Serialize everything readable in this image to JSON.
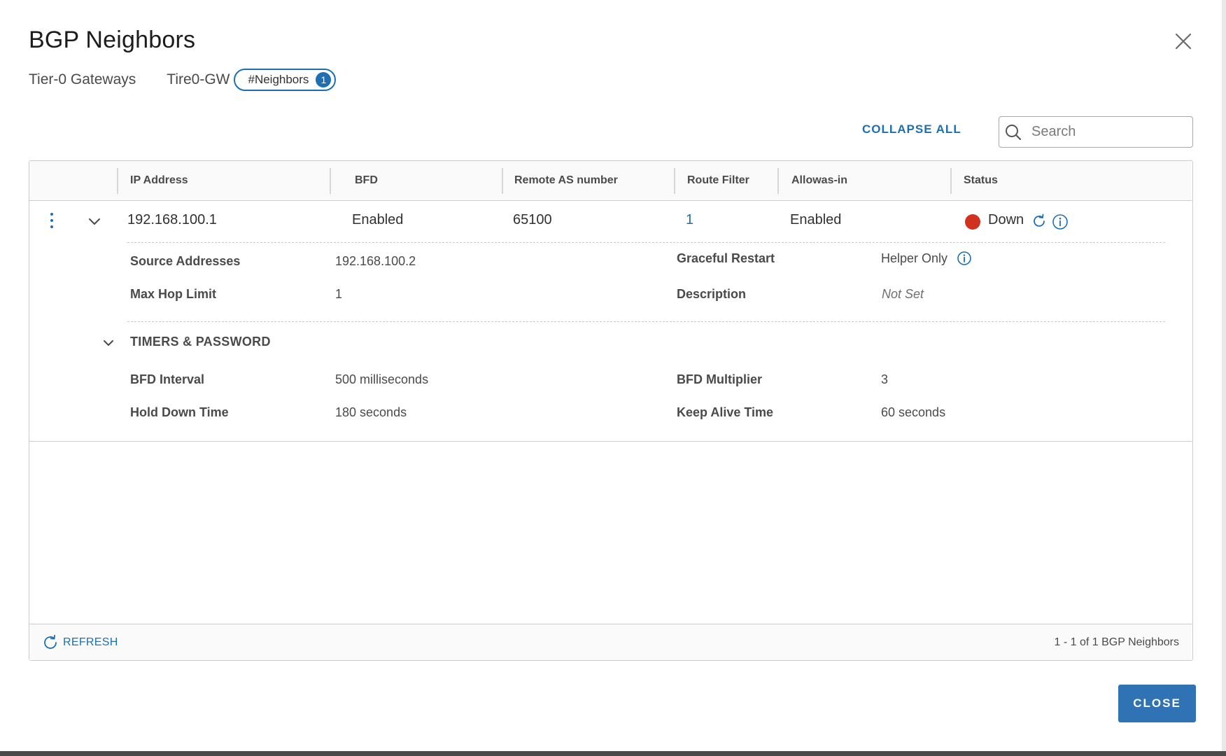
{
  "dialog": {
    "title": "BGP Neighbors",
    "close_icon": "close-icon"
  },
  "breadcrumb": {
    "gateway_type": "Tier-0 Gateways",
    "gateway_name": "Tire0-GW",
    "pill_label": "#Neighbors",
    "pill_count": "1"
  },
  "toolbar": {
    "collapse_all_label": "COLLAPSE ALL",
    "search_placeholder": "Search",
    "search_icon": "search-icon"
  },
  "table": {
    "columns": [
      "IP Address",
      "BFD",
      "Remote AS number",
      "Route Filter",
      "Allowas-in",
      "Status"
    ],
    "row": {
      "ip_address": "192.168.100.1",
      "bfd": "Enabled",
      "remote_as": "65100",
      "route_filter": "1",
      "allowas_in": "Enabled",
      "status": "Down",
      "status_color": "#d0321e"
    },
    "details": {
      "source_addresses_label": "Source Addresses",
      "source_addresses_value": "192.168.100.2",
      "max_hop_label": "Max Hop Limit",
      "max_hop_value": "1",
      "graceful_restart_label": "Graceful Restart",
      "graceful_restart_value": "Helper Only",
      "description_label": "Description",
      "description_value": "Not Set"
    },
    "timers": {
      "section_title": "TIMERS & PASSWORD",
      "bfd_interval_label": "BFD Interval",
      "bfd_interval_value": "500 milliseconds",
      "hold_down_label": "Hold Down Time",
      "hold_down_value": "180 seconds",
      "bfd_multiplier_label": "BFD Multiplier",
      "bfd_multiplier_value": "3",
      "keep_alive_label": "Keep Alive Time",
      "keep_alive_value": "60 seconds"
    },
    "footer": {
      "refresh_label": "REFRESH",
      "count_text": "1 - 1 of 1 BGP Neighbors"
    }
  },
  "actions": {
    "close_label": "CLOSE"
  },
  "colors": {
    "accent": "#1d6fb4",
    "primary_button": "#2f73b5",
    "status_down": "#d0321e"
  }
}
